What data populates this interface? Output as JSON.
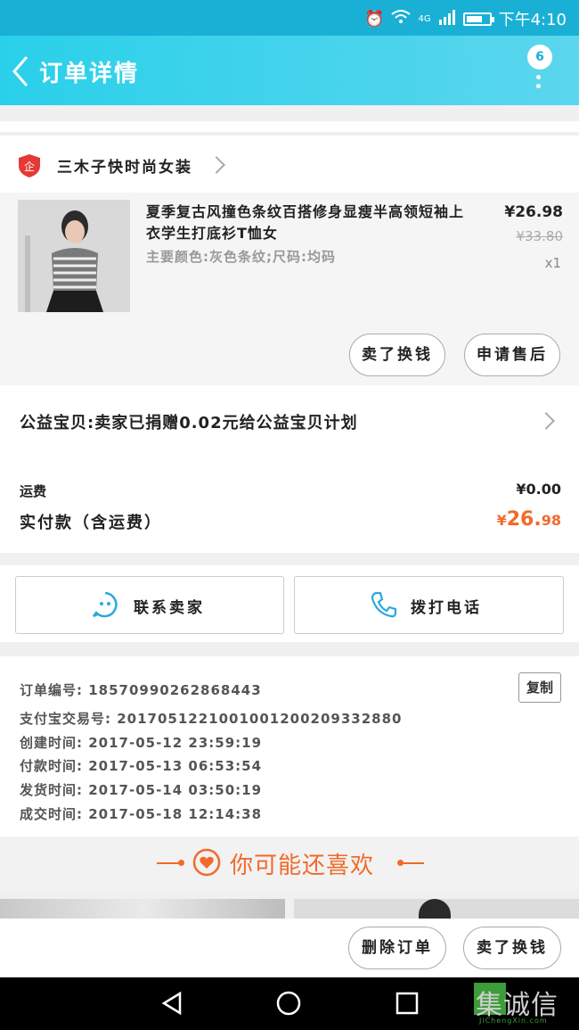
{
  "status_bar": {
    "network": "4G",
    "time": "下午4:10"
  },
  "header": {
    "title": "订单详情",
    "badge_count": "6"
  },
  "shop": {
    "name": "三木子快时尚女装",
    "icon_text": "企"
  },
  "product": {
    "title": "夏季复古风撞色条纹百搭修身显瘦半高领短袖上衣学生打底衫T恤女",
    "spec": "主要颜色:灰色条纹;尺码:均码",
    "price": "¥26.98",
    "original_price": "¥33.80",
    "quantity": "x1",
    "buttons": [
      "卖了换钱",
      "申请售后"
    ]
  },
  "charity": {
    "text": "公益宝贝:卖家已捐赠0.02元给公益宝贝计划"
  },
  "fees": {
    "shipping_label": "运费",
    "shipping_value": "¥0.00",
    "total_label": "实付款（含运费）",
    "total_currency": "¥",
    "total_int": "26.",
    "total_dec": "98"
  },
  "contact": {
    "seller": "联系卖家",
    "phone": "拨打电话"
  },
  "order_info": {
    "copy_label": "复制",
    "lines": [
      "订单编号: 18570990262868443",
      "支付宝交易号: 2017051221001001200209332880",
      "创建时间: 2017-05-12 23:59:19",
      "付款时间: 2017-05-13 06:53:54",
      "发货时间: 2017-05-14 03:50:19",
      "成交时间: 2017-05-18 12:14:38"
    ]
  },
  "recommend": {
    "title": "你可能还喜欢"
  },
  "bottom_actions": {
    "delete": "删除订单",
    "sell": "卖了换钱"
  },
  "watermark": {
    "brand": "集诚信",
    "url": "JiChengXin.com"
  },
  "colors": {
    "accent": "#1ab0d6",
    "price_orange": "#f26a2a"
  }
}
